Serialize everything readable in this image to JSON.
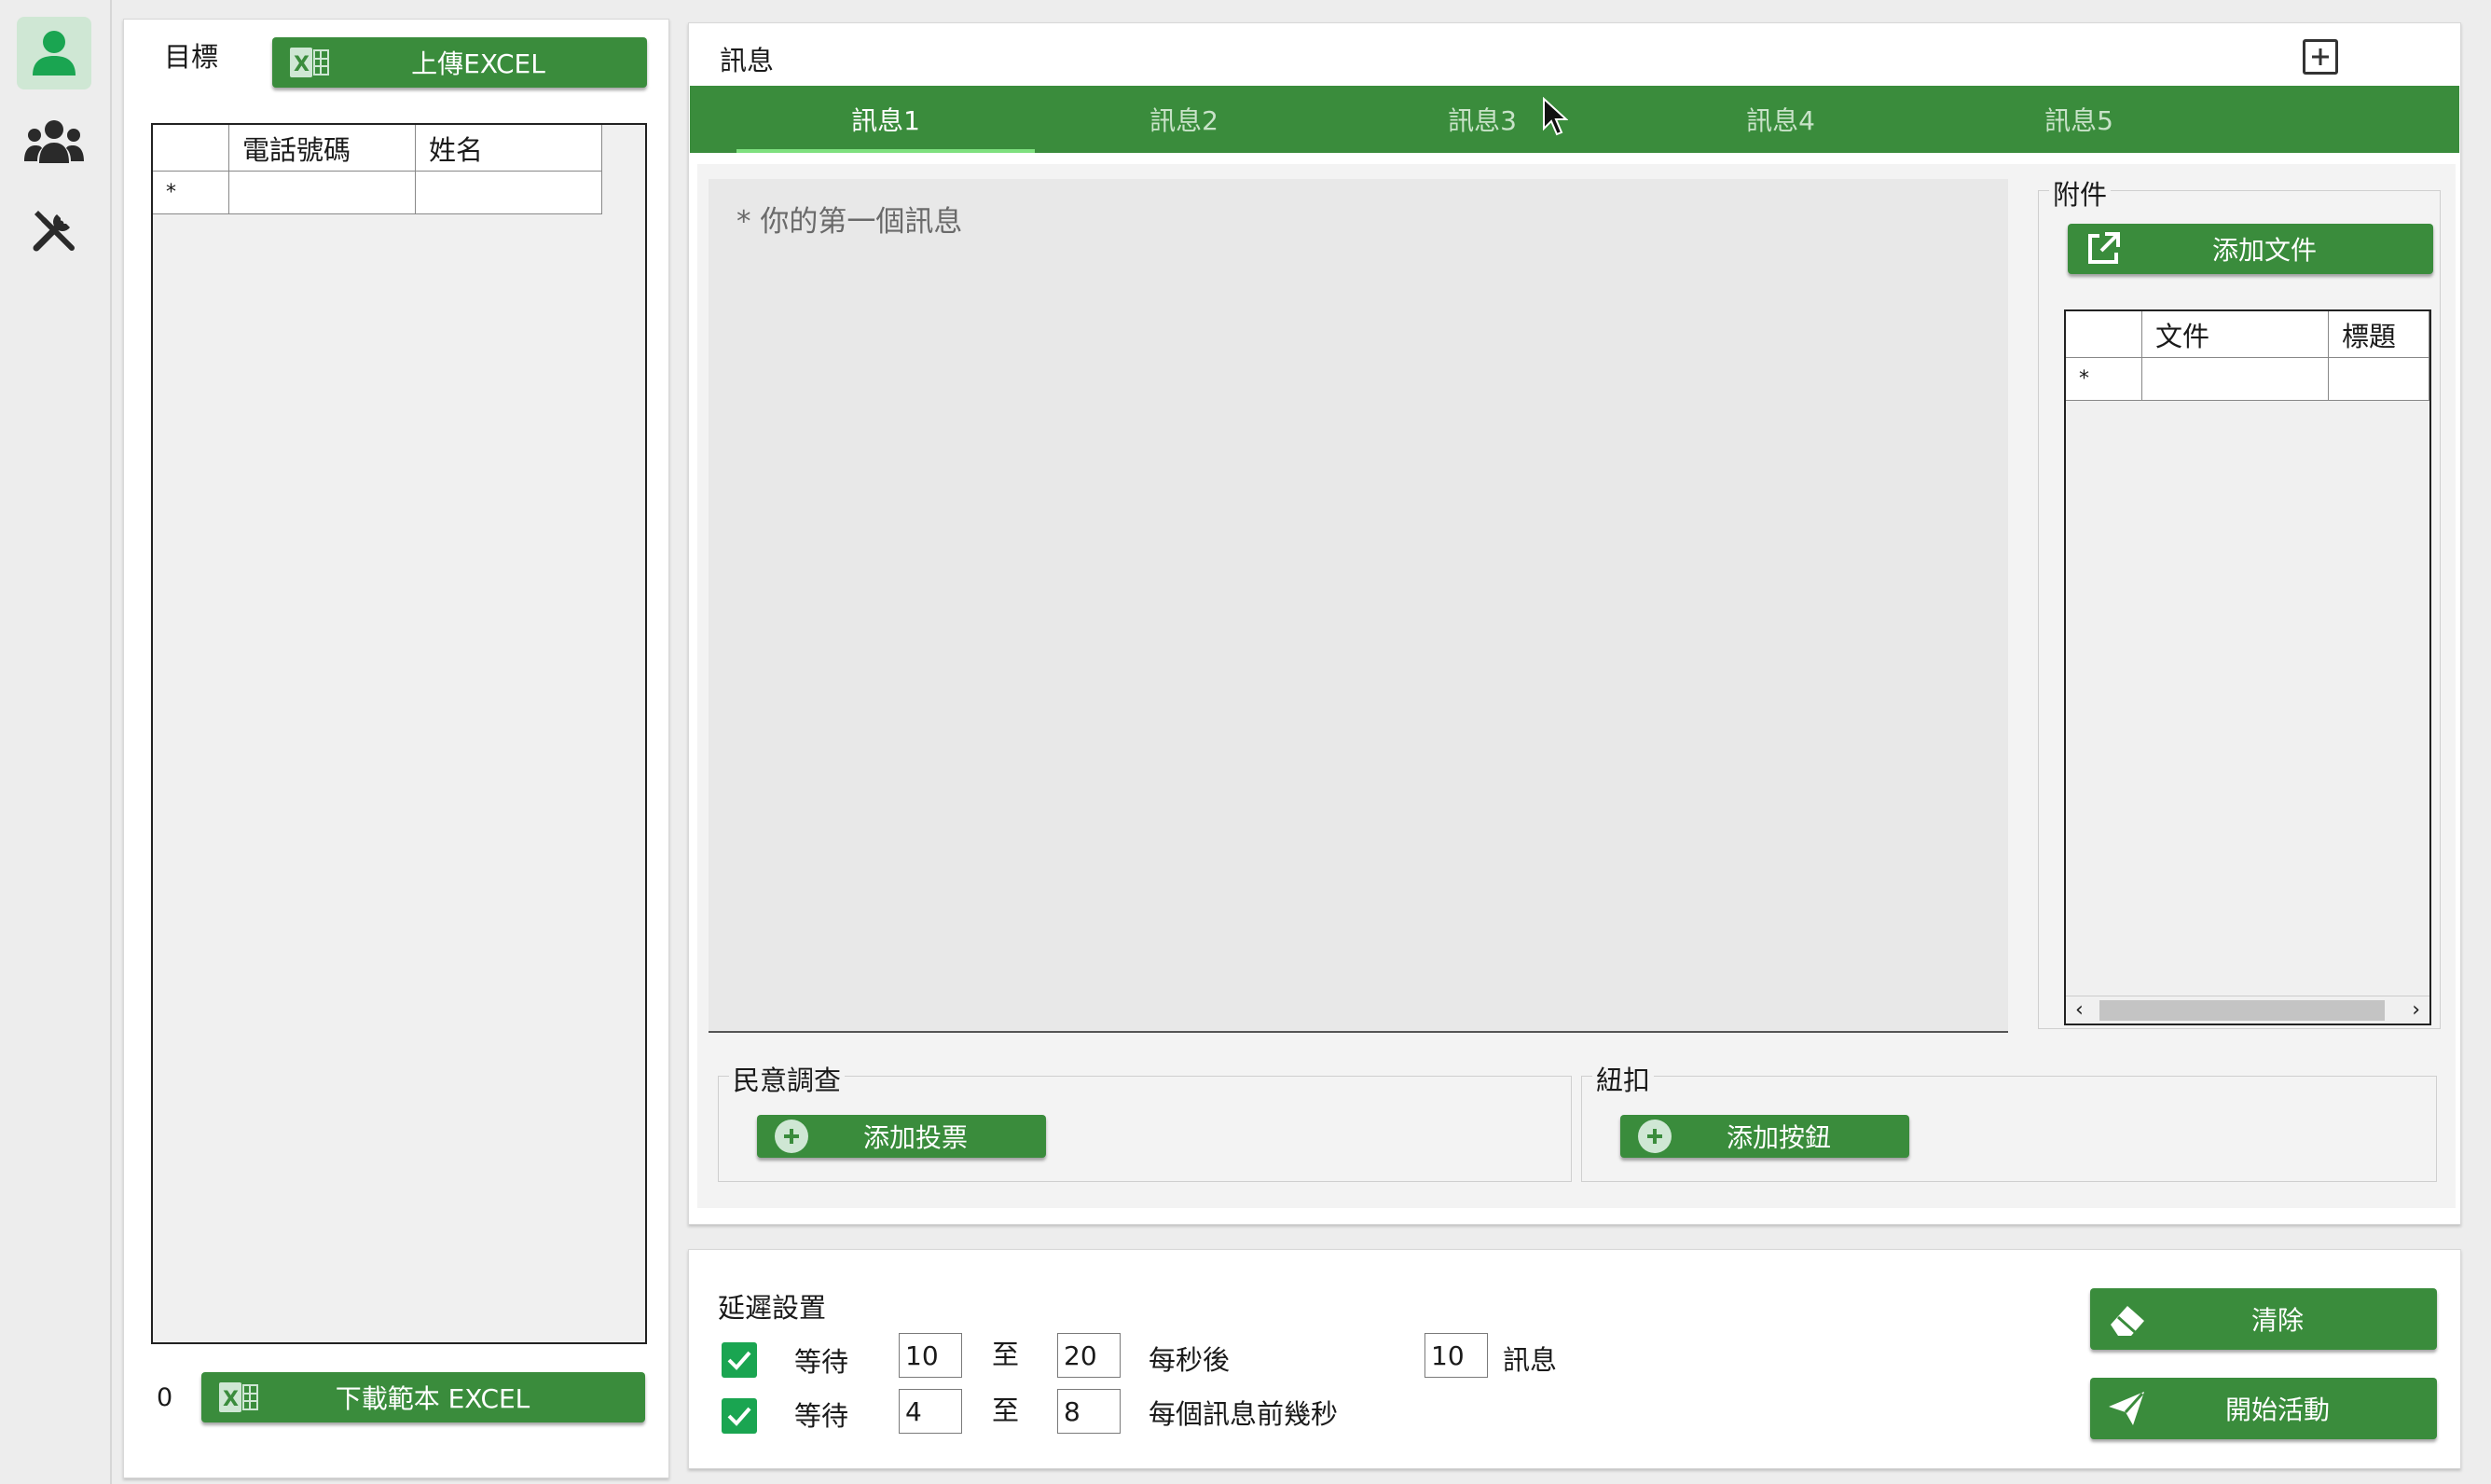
{
  "colors": {
    "accent": "#3a8c3c",
    "active_nav_bg": "#cfe7d4",
    "active_nav_icon": "#1aa551",
    "tab_underline": "#7fe07f",
    "checkbox": "#1aa551"
  },
  "sidebar": {
    "items": [
      {
        "icon": "user-icon",
        "active": true
      },
      {
        "icon": "users-group-icon",
        "active": false
      },
      {
        "icon": "tools-icon",
        "active": false
      }
    ]
  },
  "targets": {
    "title": "目標",
    "upload_label": "上傳EXCEL",
    "columns": [
      "電話號碼",
      "姓名"
    ],
    "new_row_marker": "*",
    "count": "0",
    "download_label": "下載範本 EXCEL"
  },
  "message": {
    "title": "訊息",
    "tabs": [
      "訊息1",
      "訊息2",
      "訊息3",
      "訊息4",
      "訊息5"
    ],
    "active_tab": 0,
    "placeholder": "* 你的第一個訊息",
    "attachments": {
      "title": "附件",
      "add_label": "添加文件",
      "columns": [
        "文件",
        "標題"
      ],
      "new_row_marker": "*"
    },
    "poll": {
      "title": "民意調查",
      "add_label": "添加投票"
    },
    "buttons": {
      "title": "紐扣",
      "add_label": "添加按鈕"
    }
  },
  "delay": {
    "title": "延遲設置",
    "row1": {
      "checked": true,
      "wait": "等待",
      "from": "10",
      "to_word": "至",
      "to": "20",
      "suffix": "每秒後",
      "count": "10",
      "count_suffix": "訊息"
    },
    "row2": {
      "checked": true,
      "wait": "等待",
      "from": "4",
      "to_word": "至",
      "to": "8",
      "suffix": "每個訊息前幾秒"
    }
  },
  "actions": {
    "clear_label": "清除",
    "start_label": "開始活動"
  }
}
